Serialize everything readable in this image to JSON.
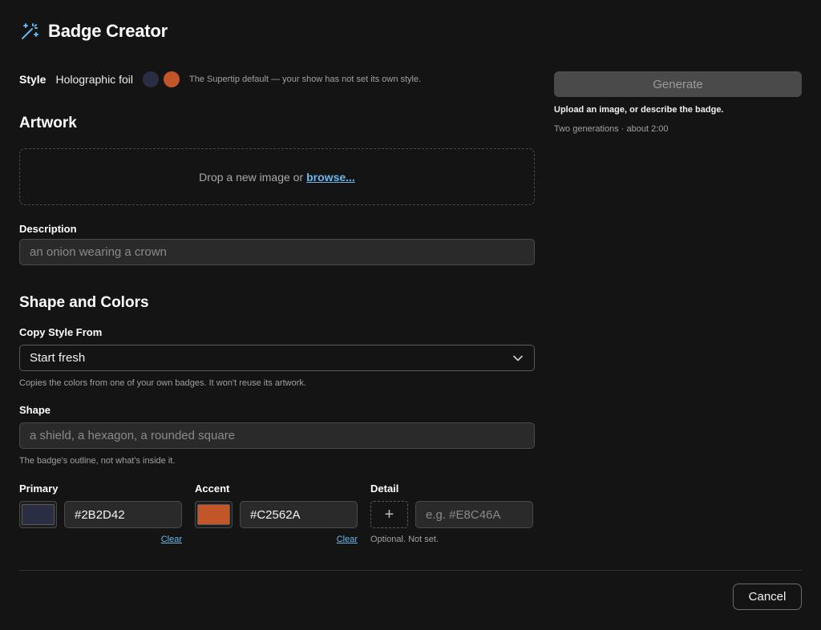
{
  "header": {
    "title": "Badge Creator",
    "icon": "magic-wand-icon",
    "icon_color": "#5fb8ee"
  },
  "style_row": {
    "label": "Style",
    "value": "Holographic foil",
    "colors": [
      "#2B2D42",
      "#C2562A"
    ],
    "note": "The Supertip default — your show has not set its own style."
  },
  "artwork": {
    "title": "Artwork",
    "drop_text": "Drop a new image or",
    "browse_label": "browse..."
  },
  "description": {
    "label": "Description",
    "placeholder": "an onion wearing a crown"
  },
  "shape_colors": {
    "title": "Shape and Colors",
    "copy_style": {
      "label": "Copy Style From",
      "selected": "Start fresh",
      "helper": "Copies the colors from one of your own badges. It won't reuse its artwork."
    },
    "shape": {
      "label": "Shape",
      "placeholder": "a shield, a hexagon, a rounded square",
      "helper": "The badge's outline, not what's inside it."
    },
    "primary": {
      "label": "Primary",
      "value": "#2B2D42",
      "swatch": "#2B2D42",
      "clear_label": "Clear"
    },
    "accent": {
      "label": "Accent",
      "value": "#C2562A",
      "swatch": "#C2562A",
      "clear_label": "Clear"
    },
    "detail": {
      "label": "Detail",
      "placeholder": "e.g. #E8C46A",
      "add_symbol": "+",
      "note": "Optional. Not set."
    }
  },
  "generate": {
    "button_label": "Generate",
    "hint": "Upload an image, or describe the badge.",
    "meta": "Two generations · about 2:00"
  },
  "footer": {
    "cancel_label": "Cancel"
  }
}
